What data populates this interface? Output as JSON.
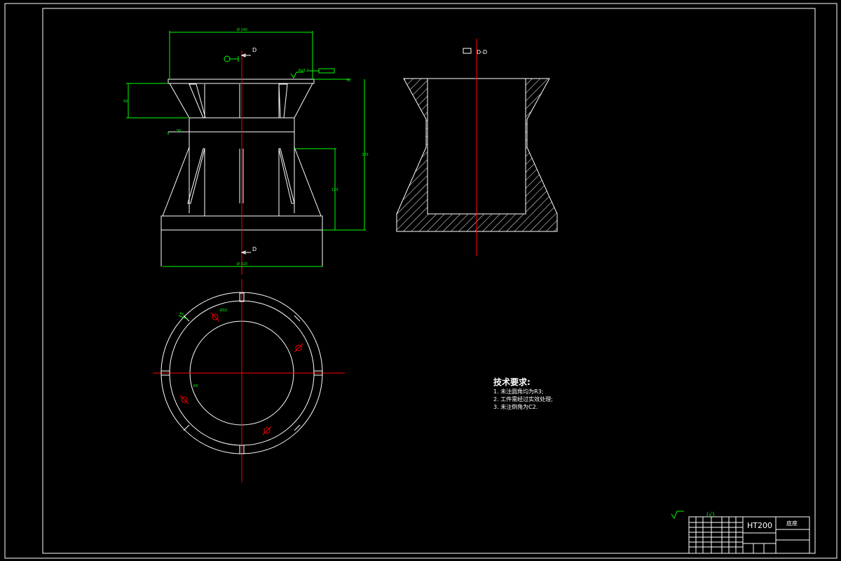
{
  "drawing": {
    "section_view_label": "D-D",
    "cut_mark_top": "D",
    "cut_mark_bottom": "D"
  },
  "tech_requirements": {
    "title": "技术要求:",
    "items": [
      "1. 未注圆角均为R3;",
      "2. 工件需经过实效处理;",
      "3. 未注倒角为C2."
    ]
  },
  "title_block": {
    "material": "HT200",
    "part_name": "底座",
    "roughness_note": "(√)"
  },
  "colors": {
    "background": "#000000",
    "outline": "#ffffff",
    "dimension": "#00ff00",
    "centerline": "#ff0000"
  }
}
